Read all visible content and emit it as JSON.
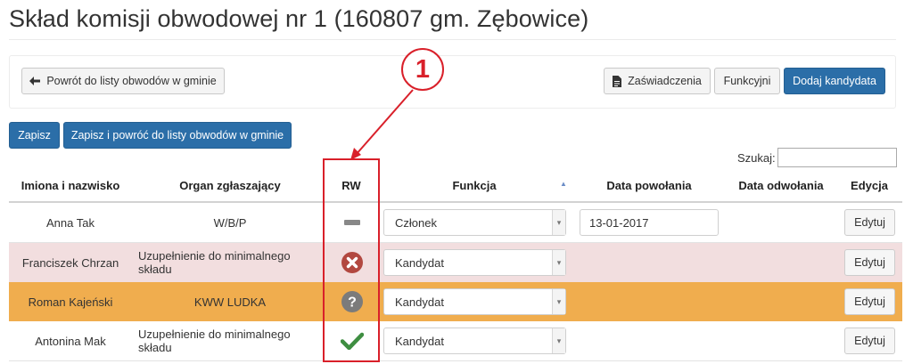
{
  "page": {
    "title": "Skład komisji obwodowej nr 1 (160807 gm. Zębowice)"
  },
  "toolbar": {
    "back_label": "Powrót do listy obwodów w gminie",
    "certificates_label": "Zaświadczenia",
    "functional_label": "Funkcyjni",
    "add_candidate_label": "Dodaj kandydata"
  },
  "actions": {
    "save_label": "Zapisz",
    "save_return_label": "Zapisz i powróć do listy obwodów w gminie"
  },
  "search": {
    "label": "Szukaj:",
    "value": ""
  },
  "table": {
    "headers": {
      "name": "Imiona i nazwisko",
      "organ": "Organ zgłaszający",
      "rw": "RW",
      "function": "Funkcja",
      "appointed": "Data powołania",
      "dismissed": "Data odwołania",
      "edit": "Edycja"
    },
    "sorted_column": "function",
    "sort_direction": "ascending",
    "rows": [
      {
        "name": "Anna Tak",
        "organ": "W/B/P",
        "rw_icon": "minus-icon",
        "rw_color": "#888888",
        "function": "Członek",
        "appointed": "13-01-2017",
        "dismissed": "",
        "edit_label": "Edytuj",
        "row_color": "#ffffff"
      },
      {
        "name": "Franciszek Chrzan",
        "organ": "Uzupełnienie do minimalnego składu",
        "rw_icon": "times-circle-icon",
        "rw_color": "#b24840",
        "function": "Kandydat",
        "appointed": "",
        "dismissed": "",
        "edit_label": "Edytuj",
        "row_color": "#f2dedf"
      },
      {
        "name": "Roman Kajeński",
        "organ": "KWW LUDKA",
        "rw_icon": "question-circle-icon",
        "rw_color": "#7b7b7b",
        "function": "Kandydat",
        "appointed": "",
        "dismissed": "",
        "edit_label": "Edytuj",
        "row_color": "#f0ad4e"
      },
      {
        "name": "Antonina Mak",
        "organ": "Uzupełnienie do minimalnego składu",
        "rw_icon": "check-icon",
        "rw_color": "#3e8e41",
        "function": "Kandydat",
        "appointed": "",
        "dismissed": "",
        "edit_label": "Edytuj",
        "row_color": "#ffffff"
      }
    ]
  },
  "annotation": {
    "number": "1",
    "color": "#d9202a"
  }
}
